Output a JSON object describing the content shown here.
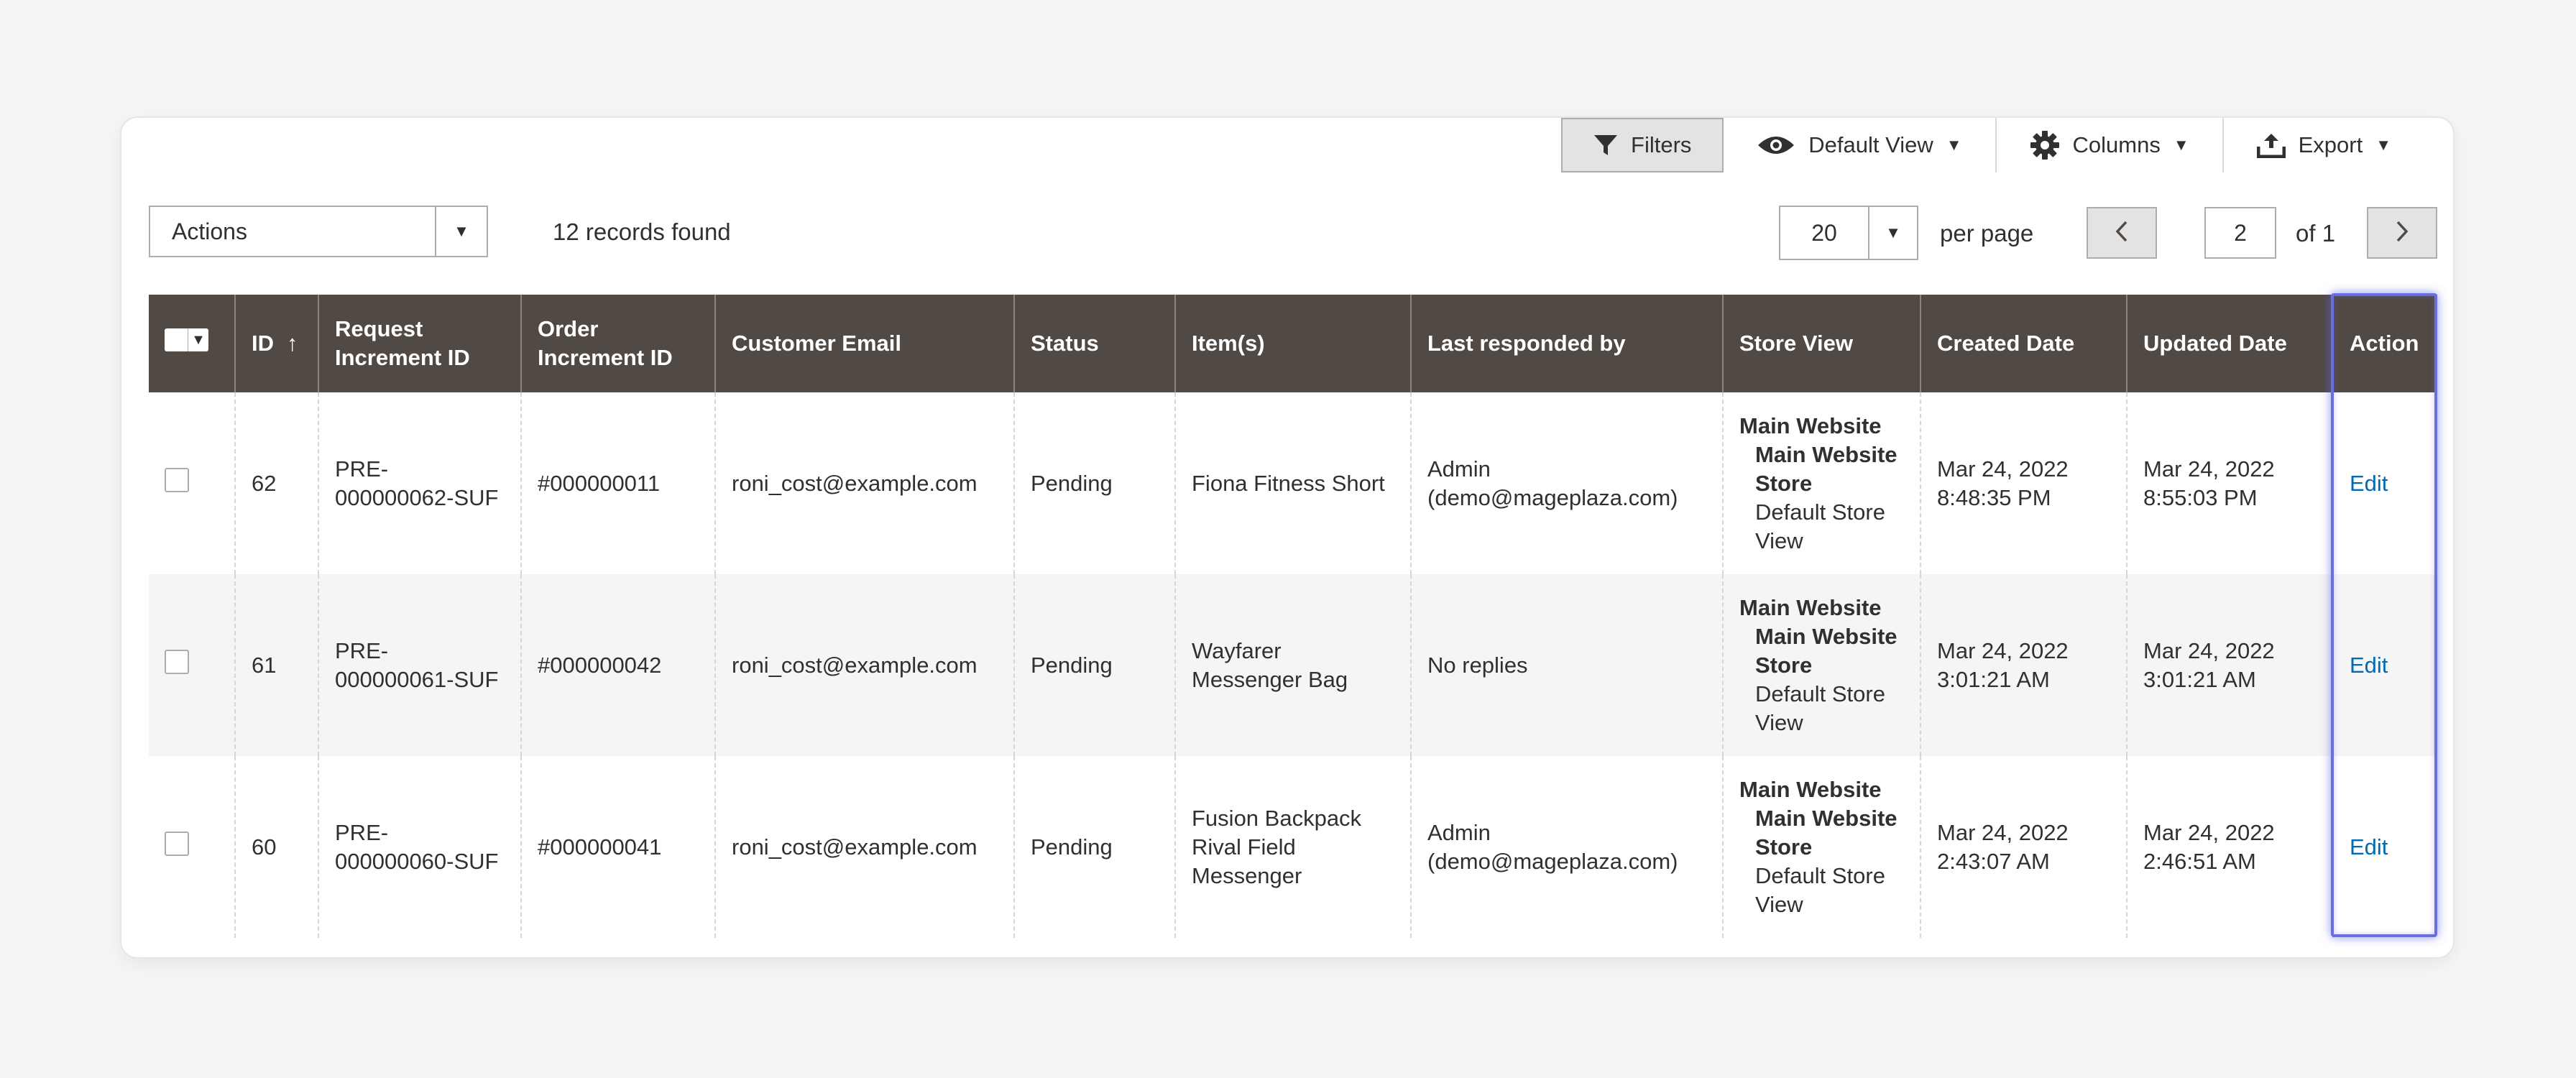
{
  "toolbar": {
    "filters_label": "Filters",
    "view_label": "Default View",
    "columns_label": "Columns",
    "export_label": "Export"
  },
  "actions": {
    "selected": "Actions"
  },
  "records_found": "12 records found",
  "pagination": {
    "per_page_value": "20",
    "per_page_label": "per page",
    "current_page": "2",
    "of_label": "of 1"
  },
  "columns": {
    "id": "ID",
    "id_sort": "↑",
    "request_id": "Request Increment ID",
    "order_id": "Order Increment ID",
    "customer_email": "Customer Email",
    "status": "Status",
    "items": "Item(s)",
    "last_responded": "Last responded by",
    "store_view": "Store View",
    "created": "Created Date",
    "updated": "Updated Date",
    "action": "Action"
  },
  "rows": [
    {
      "id": "62",
      "request_id": "PRE-000000062-SUF",
      "order_id": "#000000011",
      "email": "roni_cost@example.com",
      "status": "Pending",
      "items": "Fiona Fitness Short",
      "last_responded": "Admin (demo@mageplaza.com)",
      "store_line1": "Main Website",
      "store_line2": "Main Website Store",
      "store_line3": "Default Store View",
      "created": "Mar 24, 2022 8:48:35 PM",
      "updated": "Mar 24, 2022 8:55:03 PM",
      "action": "Edit"
    },
    {
      "id": "61",
      "request_id": "PRE-000000061-SUF",
      "order_id": "#000000042",
      "email": "roni_cost@example.com",
      "status": "Pending",
      "items": "Wayfarer Messenger Bag",
      "last_responded": "No replies",
      "store_line1": "Main Website",
      "store_line2": "Main Website Store",
      "store_line3": "Default Store View",
      "created": "Mar 24, 2022 3:01:21 AM",
      "updated": "Mar 24, 2022 3:01:21 AM",
      "action": "Edit"
    },
    {
      "id": "60",
      "request_id": "PRE-000000060-SUF",
      "order_id": "#000000041",
      "email": "roni_cost@example.com",
      "status": "Pending",
      "items": "Fusion Backpack Rival Field Messenger",
      "last_responded": "Admin (demo@mageplaza.com)",
      "store_line1": "Main Website",
      "store_line2": "Main Website Store",
      "store_line3": "Default Store View",
      "created": "Mar 24, 2022 2:43:07 AM",
      "updated": "Mar 24, 2022 2:46:51 AM",
      "action": "Edit"
    }
  ],
  "icons": {
    "filters": "funnel-icon",
    "view": "eye-icon",
    "columns": "gear-icon",
    "export": "export-upload-icon",
    "prev": "chevron-left-icon",
    "next": "chevron-right-icon"
  },
  "colors": {
    "header_bg": "#514943",
    "link": "#006bb4",
    "highlight": "#6b6fdd",
    "alt_row": "#f5f5f5"
  }
}
